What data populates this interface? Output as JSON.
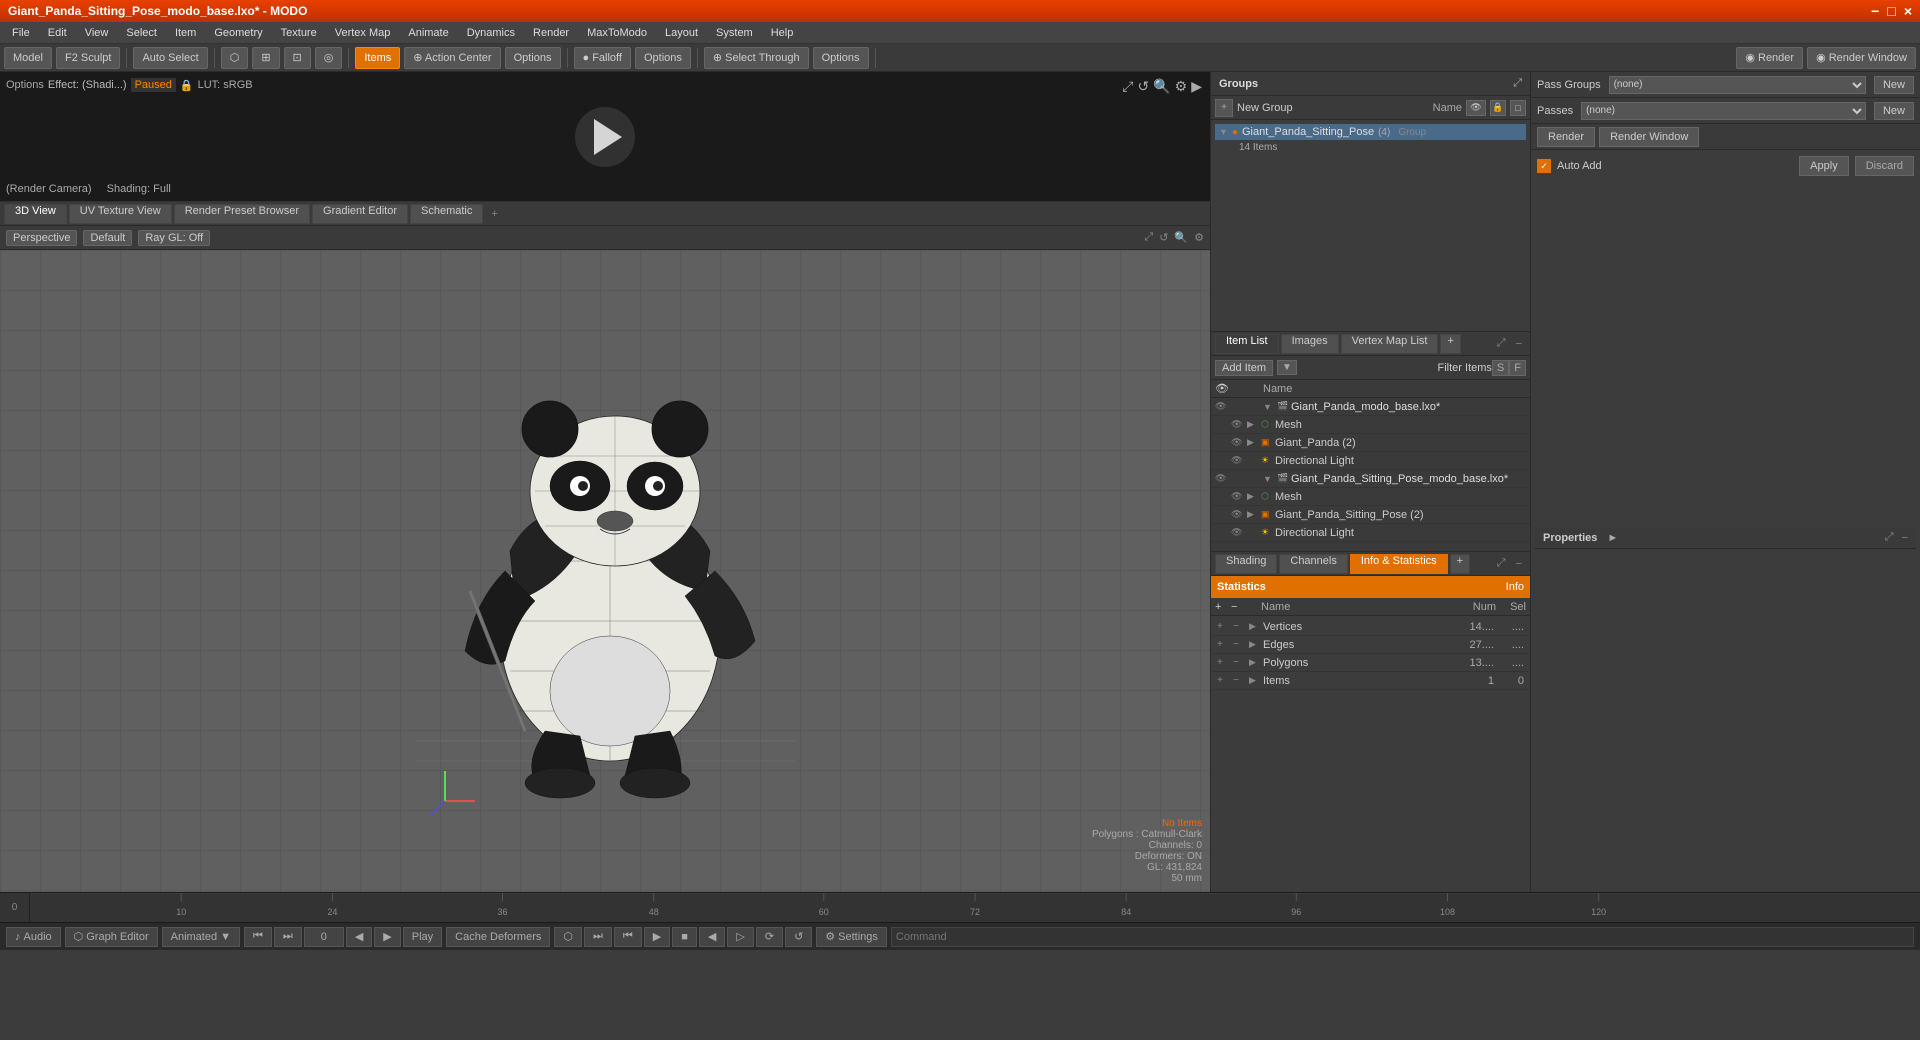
{
  "window": {
    "title": "Giant_Panda_Sitting_Pose_modo_base.lxo* - MODO"
  },
  "titlebar": {
    "title": "Giant_Panda_Sitting_Pose_modo_base.lxo* - MODO",
    "controls": [
      "−",
      "□",
      "×"
    ]
  },
  "menubar": {
    "items": [
      "File",
      "Edit",
      "View",
      "Select",
      "Item",
      "Geometry",
      "Texture",
      "Vertex Map",
      "Animate",
      "Dynamics",
      "Render",
      "MaxToModo",
      "Layout",
      "System",
      "Help"
    ]
  },
  "toolbar": {
    "mode_buttons": [
      "Model",
      "F2 Sculpt"
    ],
    "auto_select": "Auto Select",
    "tools": [
      "Select",
      "Items",
      "Action Center",
      "Options",
      "Falloff",
      "Options",
      "Select Through",
      "Options"
    ],
    "render": "Render",
    "render_window": "Render Window"
  },
  "anim_preview": {
    "options": "Options",
    "effect": "Effect: (Shadi...)",
    "paused": "Paused",
    "lut": "LUT: sRGB",
    "camera": "(Render Camera)",
    "shading": "Shading: Full"
  },
  "viewport_tabs": [
    "3D View",
    "UV Texture View",
    "Render Preset Browser",
    "Gradient Editor",
    "Schematic",
    "+"
  ],
  "viewport": {
    "perspective": "Perspective",
    "default": "Default",
    "ray_gl": "Ray GL: Off"
  },
  "viewport_info": {
    "no_items": "No Items",
    "polygons": "Polygons : Catmull-Clark",
    "channels": "Channels: 0",
    "deformers": "Deformers: ON",
    "gl": "GL: 431,824",
    "focal": "50 mm"
  },
  "groups": {
    "title": "Groups",
    "new_group": "New Group",
    "name_header": "Name",
    "items": [
      {
        "name": "Giant_Panda_Sitting_Pose",
        "badge": "(4)",
        "type": "Group",
        "indent": 0,
        "expanded": true
      },
      {
        "name": "14 Items",
        "badge": "",
        "type": "info",
        "indent": 1
      }
    ]
  },
  "pass_groups": {
    "label": "Pass Groups",
    "passes_label": "Passes",
    "select_placeholder": "(none)",
    "new_btn": "New"
  },
  "render_btns": {
    "render": "Render",
    "render_window": "Render Window"
  },
  "auto_add": {
    "label": "Auto Add",
    "apply_btn": "Apply",
    "discard_btn": "Discard"
  },
  "properties": {
    "title": "Properties",
    "expand": "►"
  },
  "item_list": {
    "tabs": [
      "Item List",
      "Images",
      "Vertex Map List",
      "+"
    ],
    "add_item": "Add Item",
    "filter": "Filter Items",
    "filter_s": "S",
    "filter_f": "F",
    "columns": [
      "Name"
    ],
    "items": [
      {
        "name": "Giant_Panda_modo_base.lxo*",
        "type": "scene",
        "indent": 0,
        "expanded": true,
        "selected": false
      },
      {
        "name": "Mesh",
        "type": "mesh",
        "indent": 1,
        "expanded": false,
        "selected": false
      },
      {
        "name": "Giant_Panda (2)",
        "type": "group",
        "indent": 1,
        "expanded": false,
        "selected": false
      },
      {
        "name": "Directional Light",
        "type": "light",
        "indent": 1,
        "expanded": false,
        "selected": false
      },
      {
        "name": "Giant_Panda_Sitting_Pose_modo_base.lxo*",
        "type": "scene",
        "indent": 0,
        "expanded": true,
        "selected": false
      },
      {
        "name": "Mesh",
        "type": "mesh",
        "indent": 1,
        "expanded": false,
        "selected": false
      },
      {
        "name": "Giant_Panda_Sitting_Pose (2)",
        "type": "group",
        "indent": 1,
        "expanded": false,
        "selected": false
      },
      {
        "name": "Directional Light",
        "type": "light",
        "indent": 1,
        "expanded": false,
        "selected": false
      }
    ]
  },
  "stats": {
    "tabs": [
      "Shading",
      "Channels",
      "Info & Statistics",
      "+"
    ],
    "active_tab": "Info & Statistics",
    "title_statistics": "Statistics",
    "title_info": "Info",
    "columns": [
      "Name",
      "Num",
      "Sel"
    ],
    "rows": [
      {
        "name": "Vertices",
        "num": "14....",
        "sel": "....",
        "has_expand": true
      },
      {
        "name": "Edges",
        "num": "27....",
        "sel": "....",
        "has_expand": true
      },
      {
        "name": "Polygons",
        "num": "13....",
        "sel": "....",
        "has_expand": true
      },
      {
        "name": "Items",
        "num": "1",
        "sel": "0",
        "has_expand": true
      }
    ]
  },
  "timeline": {
    "start": "0",
    "ticks": [
      "0",
      "10",
      "24",
      "36",
      "48",
      "60",
      "72",
      "84",
      "96",
      "108",
      "120"
    ],
    "end": "120"
  },
  "statusbar": {
    "audio": "Audio",
    "graph_editor": "Graph Editor",
    "animated": "Animated",
    "play_controls": [
      "⏮",
      "⏭",
      "▶"
    ],
    "frame": "0",
    "play": "Play",
    "cache_deformers": "Cache Deformers",
    "settings": "Settings",
    "command": "Command"
  }
}
